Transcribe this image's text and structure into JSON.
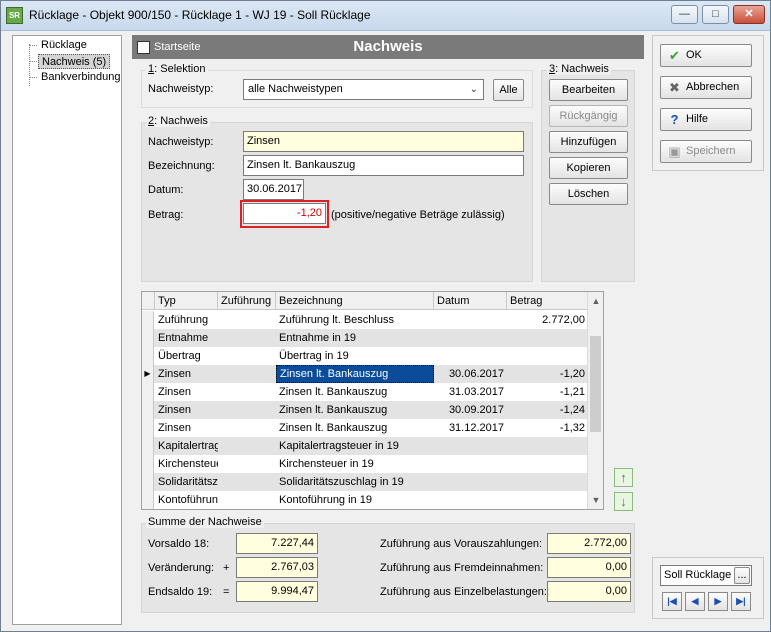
{
  "window": {
    "title": "Rücklage - Objekt 900/150 - Rücklage 1 - WJ 19 - Soll Rücklage",
    "icon_text": "SR",
    "controls": [
      "minimize",
      "maximize",
      "close"
    ]
  },
  "tree": {
    "items": [
      {
        "label": "Rücklage",
        "selected": false
      },
      {
        "label": "Nachweis (5)",
        "selected": true
      },
      {
        "label": "Bankverbindung",
        "selected": false
      }
    ]
  },
  "header": {
    "startseite_label": "Startseite",
    "title": "Nachweis"
  },
  "selektion": {
    "title_num": "1",
    "title_rest": ": Selektion",
    "nachweistyp_label": "Nachweistyp:",
    "nachweistyp_value": "alle Nachweistypen",
    "alle_button": "Alle"
  },
  "nachweis": {
    "title_num": "2",
    "title_rest": ": Nachweis",
    "typ_label": "Nachweistyp:",
    "typ_value": "Zinsen",
    "bez_label": "Bezeichnung:",
    "bez_value": "Zinsen lt. Bankauszug",
    "datum_label": "Datum:",
    "datum_value": "30.06.2017",
    "betrag_label": "Betrag:",
    "betrag_value": "-1,20",
    "betrag_hint": "(positive/negative Beträge zulässig)"
  },
  "actions": {
    "title_num": "3",
    "title_rest": ": Nachweis",
    "bearbeiten": "Bearbeiten",
    "rueckgaengig": "Rückgängig",
    "hinzufuegen": "Hinzufügen",
    "kopieren": "Kopieren",
    "loeschen": "Löschen"
  },
  "grid": {
    "headers": [
      "Typ",
      "Zuführung",
      "Bezeichnung",
      "Datum",
      "Betrag"
    ],
    "rows": [
      [
        "Zuführung",
        "",
        "Zuführung lt. Beschluss",
        "",
        "2.772,00"
      ],
      [
        "Entnahme",
        "",
        "Entnahme in 19",
        "",
        ""
      ],
      [
        "Übertrag",
        "",
        "Übertrag in 19",
        "",
        ""
      ],
      [
        "Zinsen",
        "",
        "Zinsen lt. Bankauszug",
        "30.06.2017",
        "-1,20"
      ],
      [
        "Zinsen",
        "",
        "Zinsen lt. Bankauszug",
        "31.03.2017",
        "-1,21"
      ],
      [
        "Zinsen",
        "",
        "Zinsen lt. Bankauszug",
        "30.09.2017",
        "-1,24"
      ],
      [
        "Zinsen",
        "",
        "Zinsen lt. Bankauszug",
        "31.12.2017",
        "-1,32"
      ],
      [
        "Kapitalertrags",
        "",
        "Kapitalertragsteuer in 19",
        "",
        ""
      ],
      [
        "Kirchensteue",
        "",
        "Kirchensteuer in 19",
        "",
        ""
      ],
      [
        "Solidaritätszu",
        "",
        "Solidaritätszuschlag in 19",
        "",
        ""
      ],
      [
        "Kontoführung",
        "",
        "Kontoführung in 19",
        "",
        ""
      ]
    ],
    "selected_row": 3
  },
  "summe": {
    "title": "Summe der Nachweise",
    "vorsaldo_label": "Vorsaldo 18:",
    "vorsaldo_value": "7.227,44",
    "veraenderung_label": "Veränderung:",
    "veraenderung_sign": "+",
    "veraenderung_value": "2.767,03",
    "endsaldo_label": "Endsaldo 19:",
    "endsaldo_sign": "=",
    "endsaldo_value": "9.994,47",
    "zuf_vorauszahlungen_label": "Zuführung aus Vorauszahlungen:",
    "zuf_vorauszahlungen_value": "2.772,00",
    "zuf_fremdeinnahmen_label": "Zuführung aus Fremdeinnahmen:",
    "zuf_fremdeinnahmen_value": "0,00",
    "zuf_einzelbelastungen_label": "Zuführung aus Einzelbelastungen:",
    "zuf_einzelbelastungen_value": "0,00"
  },
  "right_panel": {
    "ok": "OK",
    "abbrechen": "Abbrechen",
    "hilfe": "Hilfe",
    "speichern": "Speichern"
  },
  "record_nav": {
    "label": "Soll Rücklage",
    "browse": "..."
  },
  "colors": {
    "header_bg": "#7a7a7a",
    "selection": "#0a4c9a",
    "yellow_field": "#ffffe0",
    "error_border": "#e02020",
    "negative_text": "#d00000"
  }
}
